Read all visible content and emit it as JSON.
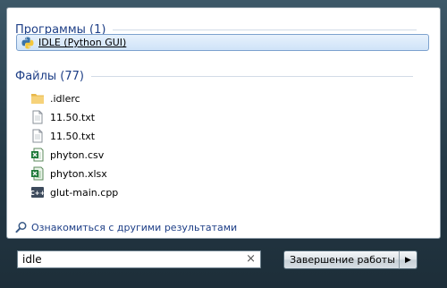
{
  "results": {
    "programs_header": "Программы (1)",
    "selected_program": {
      "label": "IDLE (Python GUI)",
      "icon": "python-icon"
    },
    "files_header": "Файлы (77)",
    "files": [
      {
        "label": ".idlerc",
        "icon": "folder-icon"
      },
      {
        "label": "11.50.txt",
        "icon": "text-file-icon"
      },
      {
        "label": "11.50.txt",
        "icon": "text-file-icon"
      },
      {
        "label": "phyton.csv",
        "icon": "excel-csv-icon"
      },
      {
        "label": "phyton.xlsx",
        "icon": "excel-xlsx-icon"
      },
      {
        "label": "glut-main.cpp",
        "icon": "cpp-file-icon"
      }
    ],
    "see_more": "Ознакомиться с другими результатами"
  },
  "search": {
    "value": "idle",
    "clear": "×"
  },
  "shutdown": {
    "label": "Завершение работы",
    "arrow": "▶"
  },
  "colors": {
    "header_text": "#1e3f87",
    "selection_border": "#7da2ce",
    "panel_bg": "#ffffff",
    "frame_bg": "#2a3f4c"
  }
}
